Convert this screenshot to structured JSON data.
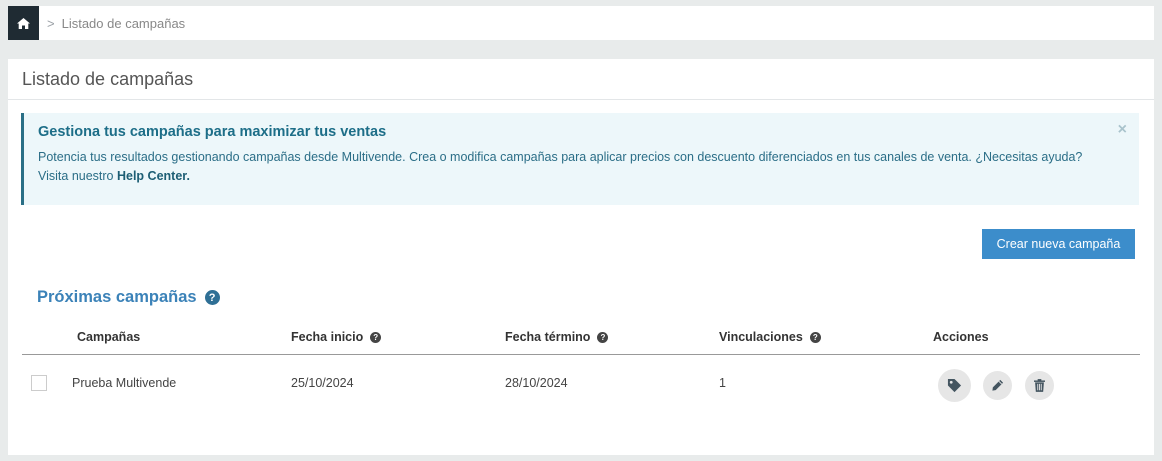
{
  "breadcrumb": {
    "home_icon": "home-icon",
    "separator": ">",
    "current": "Listado de campañas"
  },
  "panel": {
    "title": "Listado de campañas"
  },
  "alert": {
    "title": "Gestiona tus campañas para maximizar tus ventas",
    "text": "Potencia tus resultados gestionando campañas desde Multivende. Crea o modifica campañas para aplicar precios con descuento diferenciados en tus canales de venta. ¿Necesitas ayuda? Visita nuestro ",
    "link": "Help Center.",
    "close": "×"
  },
  "actions": {
    "create_label": "Crear nueva campaña"
  },
  "section": {
    "title": "Próximas campañas",
    "help": "?"
  },
  "table": {
    "columns": [
      "Campañas",
      "Fecha inicio",
      "Fecha término",
      "Vinculaciones",
      "Acciones"
    ],
    "help": "?",
    "rows": [
      {
        "name": "Prueba Multivende",
        "start": "25/10/2024",
        "end": "28/10/2024",
        "links": "1"
      }
    ]
  },
  "colors": {
    "primary": "#3c8dcb",
    "alert_bg": "#edf7fa",
    "alert_text": "#1d6e88",
    "dark": "#1f2b33"
  }
}
